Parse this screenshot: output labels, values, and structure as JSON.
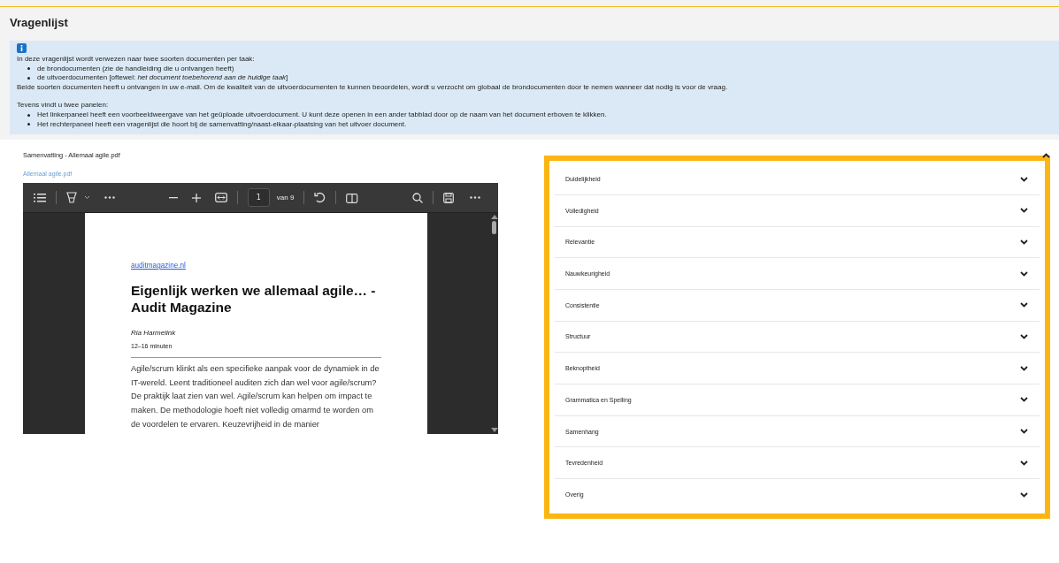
{
  "page": {
    "title": "Vragenlijst"
  },
  "info": {
    "intro": "In deze vragenlijst wordt verwezen naar twee soorten documenten per taak:",
    "doc_types": [
      "de brondocumenten (zie de handleiding die u ontvangen heeft)",
      "de uitvoerdocumenten [oftewel: *het document toebehorend aan de huidige taak*]"
    ],
    "note": "Beide soorten documenten heeft u ontvangen in uw e-mail. Om de kwaliteit van de uitvoerdocumenten te kunnen beoordelen, wordt u verzocht om globaal de brondocumenten door te nemen wanneer dat nodig is voor de vraag.",
    "panels_intro": "Tevens vindt u twee panelen:",
    "panels": [
      "Het linkerpaneel heeft een voorbeeldweergave van het geüploade uitvoerdocument. U kunt deze openen in een ander tabblad door op de naam van het document erboven te klikken.",
      "Het rechterpaneel heeft een vragenlijst die hoort bij de samenvatting/naast-elkaar-plaatsing van het uitvoer document."
    ]
  },
  "section": {
    "title": "Samenvatting - Allemaal agile.pdf",
    "expanded": true,
    "document_link": "Allemaal agile.pdf"
  },
  "pdf_viewer": {
    "page_number": "1",
    "page_count": "van 9",
    "document": {
      "source_link": "auditmagazine.nl",
      "heading": "Eigenlijk werken we allemaal agile… - Audit Magazine",
      "author": "Ria Harmelink",
      "reading_time": "12–16 minuten",
      "body": "Agile/scrum klinkt als een specifieke aanpak voor de dynamiek in de IT-wereld. Leent traditioneel auditen zich dan wel voor agile/scrum? De praktijk laat zien van wel. Agile/scrum kan helpen om impact te maken. De methodologie hoeft niet volledig omarmd te worden om de voordelen te ervaren. Keuzevrijheid in de manier"
    }
  },
  "questions": [
    {
      "label": "Duidelijkheid",
      "expanded": false
    },
    {
      "label": "Volledigheid",
      "expanded": false
    },
    {
      "label": "Relevantie",
      "expanded": false
    },
    {
      "label": "Nauwkeurigheid",
      "expanded": false
    },
    {
      "label": "Consistentie",
      "expanded": false
    },
    {
      "label": "Structuur",
      "expanded": false
    },
    {
      "label": "Beknoptheid",
      "expanded": false
    },
    {
      "label": "Grammatica en Spelling",
      "expanded": false
    },
    {
      "label": "Samenhang",
      "expanded": false
    },
    {
      "label": "Tevredenheid",
      "expanded": false
    },
    {
      "label": "Overig",
      "expanded": false
    }
  ]
}
